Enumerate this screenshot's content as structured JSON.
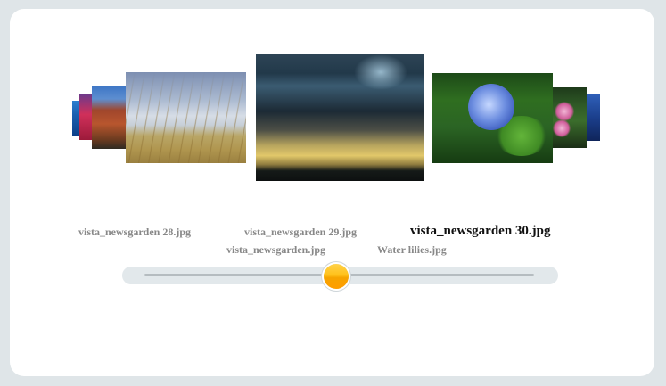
{
  "gallery": {
    "items": [
      {
        "label": "vista_newsgarden 28.jpg",
        "image": "grass-sky-photo"
      },
      {
        "label": "vista_newsgarden 29.jpg",
        "image": "storm-clouds-photo"
      },
      {
        "label": "vista_newsgarden 30.jpg",
        "image": "blue-flower-photo",
        "selected": true
      },
      {
        "label": "vista_newsgarden.jpg",
        "image": "garden-photo"
      },
      {
        "label": "Water lilies.jpg",
        "image": "water-lilies-photo"
      }
    ],
    "slider": {
      "position": 0.5
    }
  },
  "colors": {
    "frame": "#dfe5e8",
    "panel": "#ffffff",
    "label_inactive": "#888888",
    "label_active": "#111111",
    "slider_track": "#e2e8eb",
    "slider_thumb": "#ffb10a"
  }
}
